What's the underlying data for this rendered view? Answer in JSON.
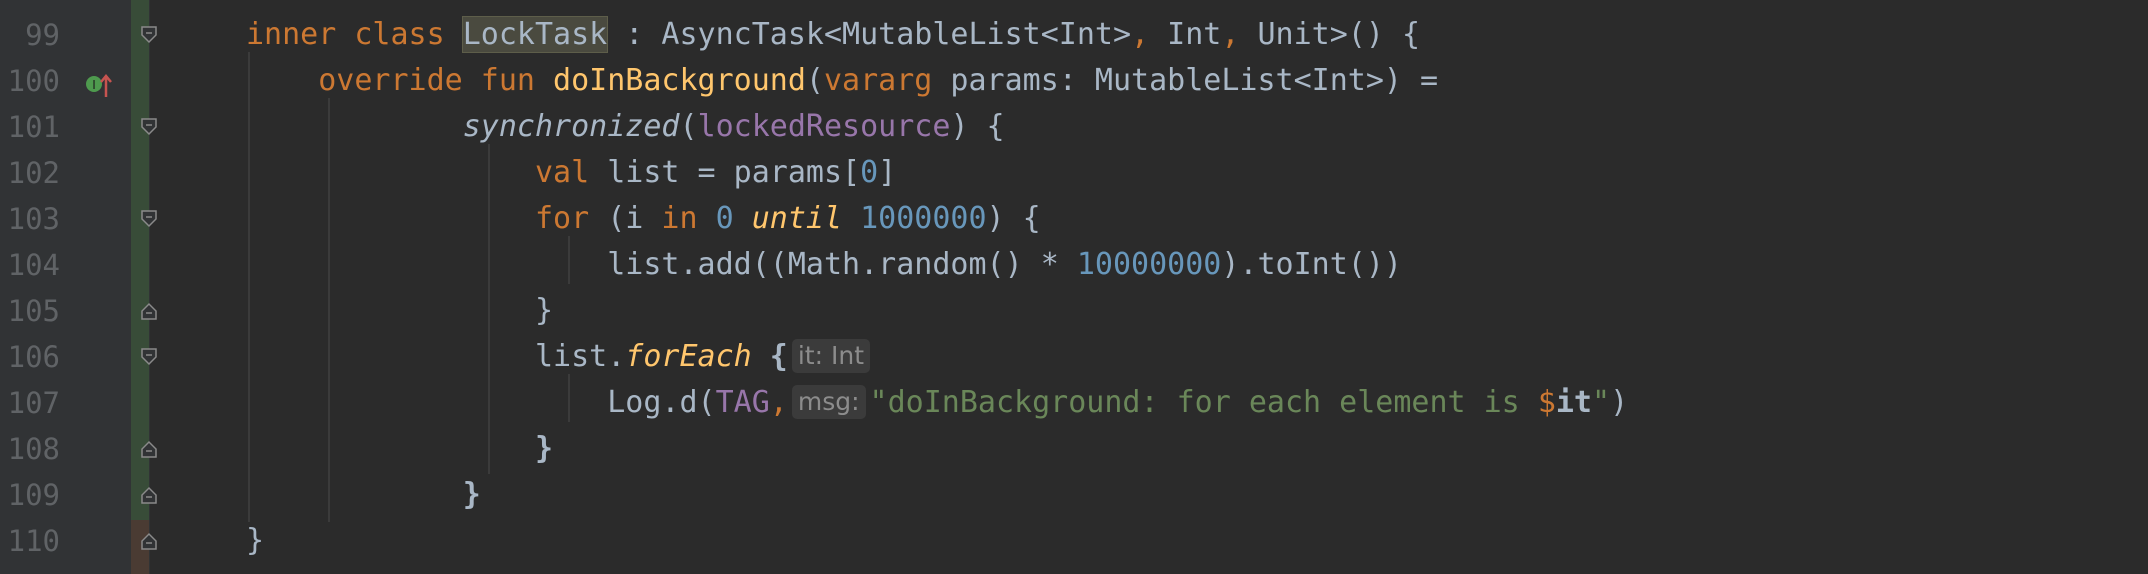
{
  "editor": {
    "lines": [
      {
        "number": "99",
        "tokens": [
          {
            "t": "inner class ",
            "c": "kw"
          },
          {
            "t": "LockTask",
            "c": "plain hl"
          },
          {
            "t": " : AsyncTask<MutableList<Int>",
            "c": "plain"
          },
          {
            "t": ",",
            "c": "kw"
          },
          {
            "t": " Int",
            "c": "plain"
          },
          {
            "t": ",",
            "c": "kw"
          },
          {
            "t": " Unit>() {",
            "c": "plain"
          }
        ]
      },
      {
        "number": "100",
        "tokens": [
          {
            "t": "    override fun ",
            "c": "kw"
          },
          {
            "t": "doInBackground",
            "c": "fn"
          },
          {
            "t": "(",
            "c": "plain"
          },
          {
            "t": "vararg ",
            "c": "kw"
          },
          {
            "t": "params: MutableList<Int>) =",
            "c": "plain"
          }
        ]
      },
      {
        "number": "101",
        "tokens": [
          {
            "t": "            ",
            "c": "plain"
          },
          {
            "t": "synchronized",
            "c": "plain ital"
          },
          {
            "t": "(",
            "c": "plain"
          },
          {
            "t": "lockedResource",
            "c": "purple"
          },
          {
            "t": ") {",
            "c": "plain"
          }
        ]
      },
      {
        "number": "102",
        "tokens": [
          {
            "t": "                ",
            "c": "plain"
          },
          {
            "t": "val ",
            "c": "kw"
          },
          {
            "t": "list = params[",
            "c": "plain"
          },
          {
            "t": "0",
            "c": "num"
          },
          {
            "t": "]",
            "c": "plain"
          }
        ]
      },
      {
        "number": "103",
        "tokens": [
          {
            "t": "                ",
            "c": "plain"
          },
          {
            "t": "for ",
            "c": "kw"
          },
          {
            "t": "(i ",
            "c": "plain"
          },
          {
            "t": "in ",
            "c": "kw"
          },
          {
            "t": "0 ",
            "c": "num"
          },
          {
            "t": "until ",
            "c": "fn ital"
          },
          {
            "t": "1000000",
            "c": "num"
          },
          {
            "t": ") {",
            "c": "plain"
          }
        ]
      },
      {
        "number": "104",
        "tokens": [
          {
            "t": "                    list.add((Math.random() * ",
            "c": "plain"
          },
          {
            "t": "10000000",
            "c": "num"
          },
          {
            "t": ").toInt())",
            "c": "plain"
          }
        ]
      },
      {
        "number": "105",
        "tokens": [
          {
            "t": "                }",
            "c": "plain"
          }
        ]
      },
      {
        "number": "106",
        "tokens": [
          {
            "t": "                list.",
            "c": "plain"
          },
          {
            "t": "forEach",
            "c": "fn ital"
          },
          {
            "t": " {",
            "c": "plain bold"
          },
          {
            "hint": "it: Int"
          }
        ]
      },
      {
        "number": "107",
        "tokens": [
          {
            "t": "                    Log.d(",
            "c": "plain"
          },
          {
            "t": "TAG",
            "c": "purple"
          },
          {
            "t": ",",
            "c": "kw"
          },
          {
            "hint": "msg:"
          },
          {
            "t": "\"doInBackground: for each element is ",
            "c": "str"
          },
          {
            "t": "$",
            "c": "kw"
          },
          {
            "t": "it",
            "c": "plain bold"
          },
          {
            "t": "\"",
            "c": "str"
          },
          {
            "t": ")",
            "c": "plain"
          }
        ]
      },
      {
        "number": "108",
        "tokens": [
          {
            "t": "                }",
            "c": "plain bold"
          }
        ]
      },
      {
        "number": "109",
        "tokens": [
          {
            "t": "            }",
            "c": "plain bold"
          }
        ]
      },
      {
        "number": "110",
        "tokens": [
          {
            "t": "}",
            "c": "plain"
          }
        ]
      }
    ],
    "fold_markers": [
      {
        "line": "99",
        "kind": "open"
      },
      {
        "line": "101",
        "kind": "open"
      },
      {
        "line": "103",
        "kind": "open"
      },
      {
        "line": "105",
        "kind": "close"
      },
      {
        "line": "106",
        "kind": "open"
      },
      {
        "line": "108",
        "kind": "close"
      },
      {
        "line": "109",
        "kind": "close"
      },
      {
        "line": "110",
        "kind": "close"
      }
    ],
    "gutter_marker": {
      "line": "100",
      "icon": "implements-override-icon",
      "color": "#4e9a4e",
      "arrow_color": "#c75450"
    },
    "colors": {
      "background": "#2b2b2b",
      "gutter": "#313335",
      "keyword": "#cc7832",
      "function": "#ffc66d",
      "number": "#6897bb",
      "field": "#9876aa",
      "string": "#6a8759",
      "text": "#a9b7c6"
    }
  }
}
